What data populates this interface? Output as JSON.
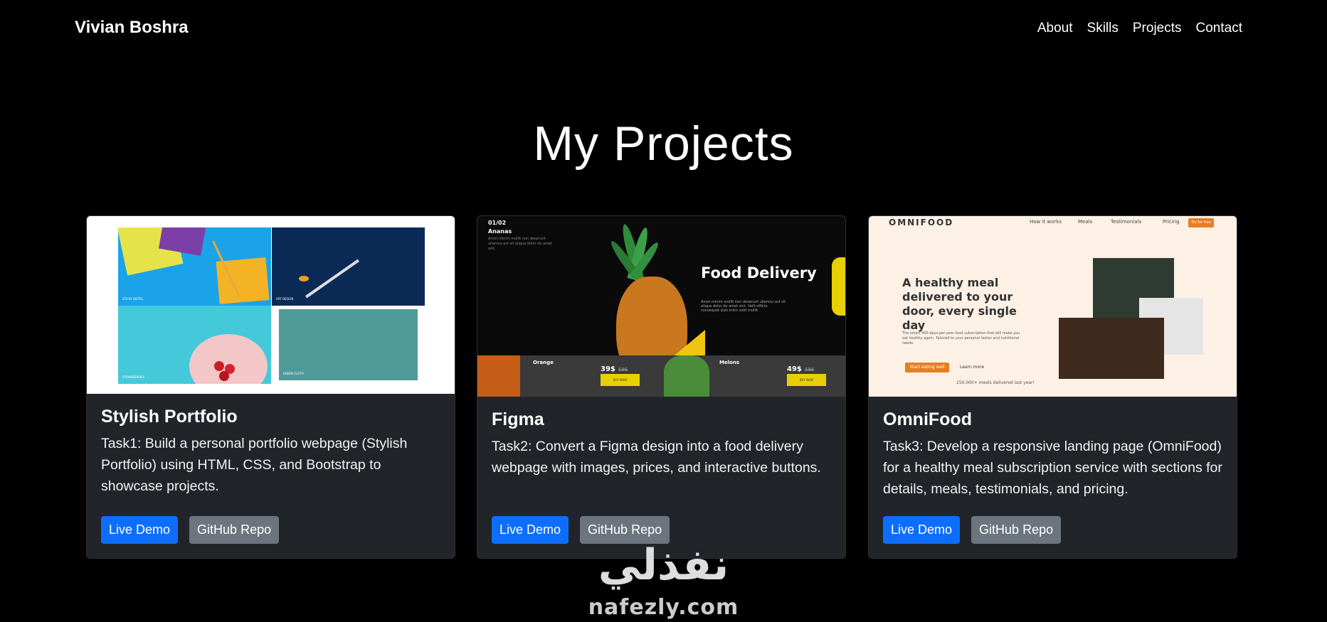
{
  "navbar": {
    "brand": "Vivian Boshra",
    "links": [
      "About",
      "Skills",
      "Projects",
      "Contact"
    ]
  },
  "projects_section": {
    "title": "My Projects"
  },
  "cards": [
    {
      "title": "Stylish Portfolio",
      "description": "Task1: Build a personal portfolio webpage (Stylish Portfolio) using HTML, CSS, and Bootstrap to showcase projects.",
      "live_label": "Live Demo",
      "repo_label": "GitHub Repo",
      "preview": {
        "captions": [
          "STICKY NOTES",
          "ART DESIGN",
          "STRAWBERRIES",
          "GREEN CLOTH"
        ]
      }
    },
    {
      "title": "Figma",
      "description": "Task2: Convert a Figma design into a food delivery webpage with images, prices, and interactive buttons.",
      "live_label": "Live Demo",
      "repo_label": "GitHub Repo",
      "preview": {
        "counter": "01/02",
        "fruit": "Ananas",
        "hero": "Food Delivery",
        "items": [
          {
            "name": "Orange",
            "price": "39$",
            "old": "59$"
          },
          {
            "name": "Melons",
            "price": "49$",
            "old": "59$"
          }
        ]
      }
    },
    {
      "title": "OmniFood",
      "description": "Task3: Develop a responsive landing page (OmniFood) for a healthy meal subscription service with sections for details, meals, testimonials, and pricing.",
      "live_label": "Live Demo",
      "repo_label": "GitHub Repo",
      "preview": {
        "logo": "OMNIFOOD",
        "nav": [
          "How it works",
          "Meals",
          "Testimonials",
          "Pricing"
        ],
        "cta": "Try for free",
        "headline": "A healthy meal delivered to your door, every single day",
        "start_btn": "Start eating well",
        "learn_btn": "Learn more",
        "meals_text": "250,000+ meals delivered last year!"
      }
    }
  ],
  "watermark": {
    "arabic": "نفذلي",
    "latin": "nafezly.com"
  },
  "colors": {
    "background": "#000000",
    "card": "#212529",
    "primary": "#0d6efd",
    "secondary": "#6c757d"
  }
}
